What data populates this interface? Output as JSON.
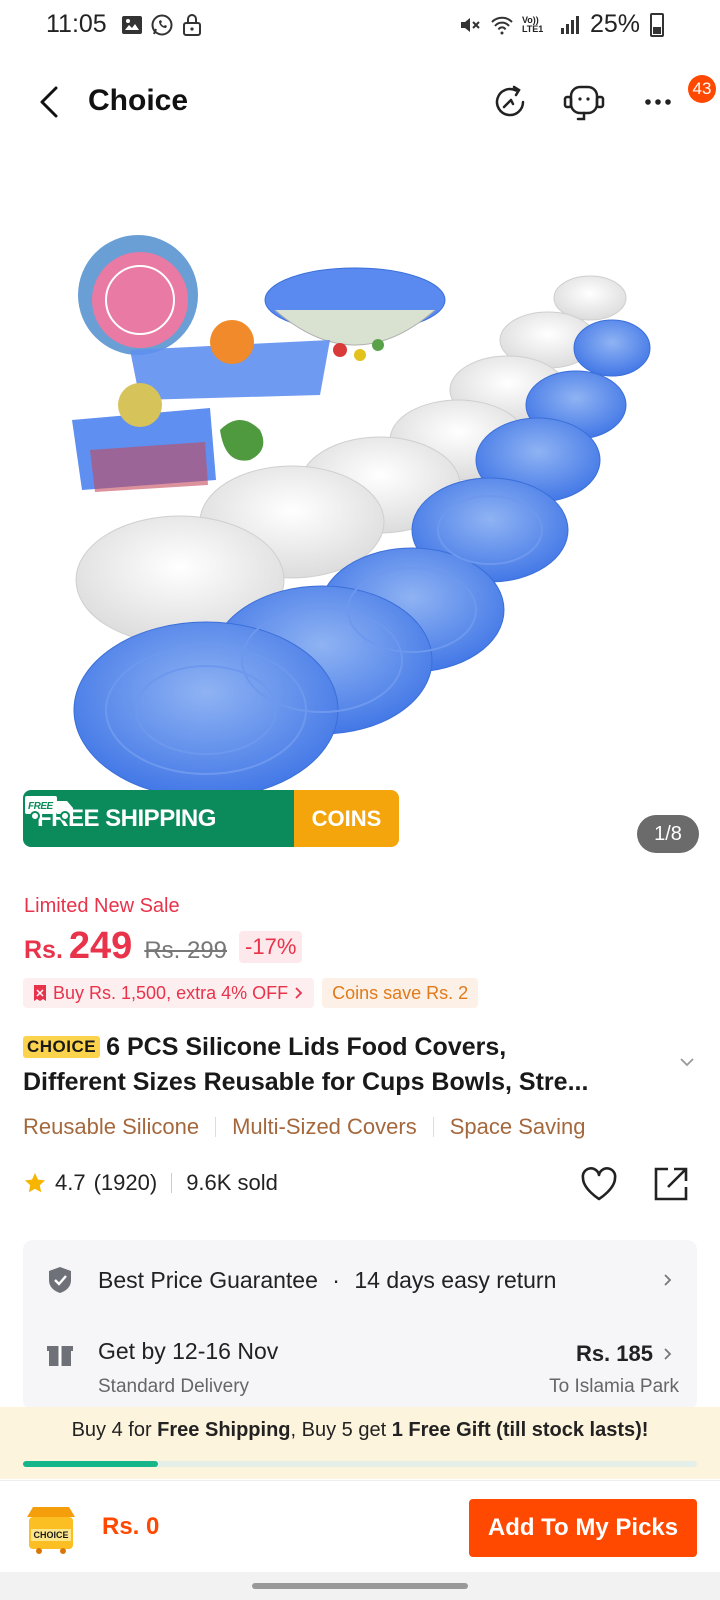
{
  "status_bar": {
    "time": "11:05",
    "battery": "25%",
    "icons": [
      "gallery-icon",
      "whatsapp-icon",
      "lock-icon",
      "mute-icon",
      "wifi-icon",
      "volte-icon",
      "signal-icon",
      "battery-icon"
    ],
    "volte": "Vo)) LTE1"
  },
  "header": {
    "title": "Choice",
    "notification_count": "43",
    "icons": [
      "back-icon",
      "history-icon",
      "support-icon",
      "more-icon"
    ]
  },
  "gallery": {
    "free_shipping": "FREE SHIPPING",
    "free_badge": "FREE",
    "coins": "COINS",
    "counter": "1/8"
  },
  "pricing": {
    "sale_label": "Limited New Sale",
    "currency": "Rs.",
    "price": "249",
    "old_price": "Rs. 299",
    "discount": "-17%"
  },
  "promos": {
    "bulk": "Buy Rs. 1,500, extra 4% OFF",
    "coins": "Coins save Rs. 2"
  },
  "product": {
    "tag": "CHOICE",
    "title_line1": "6 PCS Silicone Lids Food Covers,",
    "title_line2": "Different Sizes Reusable for Cups Bowls, Stre..."
  },
  "features": [
    "Reusable Silicone",
    "Multi-Sized Covers",
    "Space Saving"
  ],
  "rating": {
    "score": "4.7",
    "count": "(1920)",
    "sold": "9.6K sold"
  },
  "service": {
    "guarantee": "Best Price Guarantee",
    "dot": "·",
    "return": "14 days easy return",
    "delivery_date": "Get by 12-16 Nov",
    "delivery_type": "Standard Delivery",
    "delivery_price": "Rs. 185",
    "delivery_location": "To Islamia Park"
  },
  "free_ship_bar": {
    "part1": "Buy 4 for ",
    "part2": "Free Shipping",
    "part3": ", Buy 5 get ",
    "part4": "1 Free Gift (till stock lasts)!",
    "progress": 0.2
  },
  "bottom": {
    "cart_label": "CHOICE",
    "total": "Rs. 0",
    "add_button": "Add To My Picks"
  },
  "colors": {
    "accent": "#ff4800",
    "sale": "#e8334b",
    "shipping_green": "#0b8a5c",
    "coins_orange": "#f4a50c",
    "feature_brown": "#a5683d"
  }
}
